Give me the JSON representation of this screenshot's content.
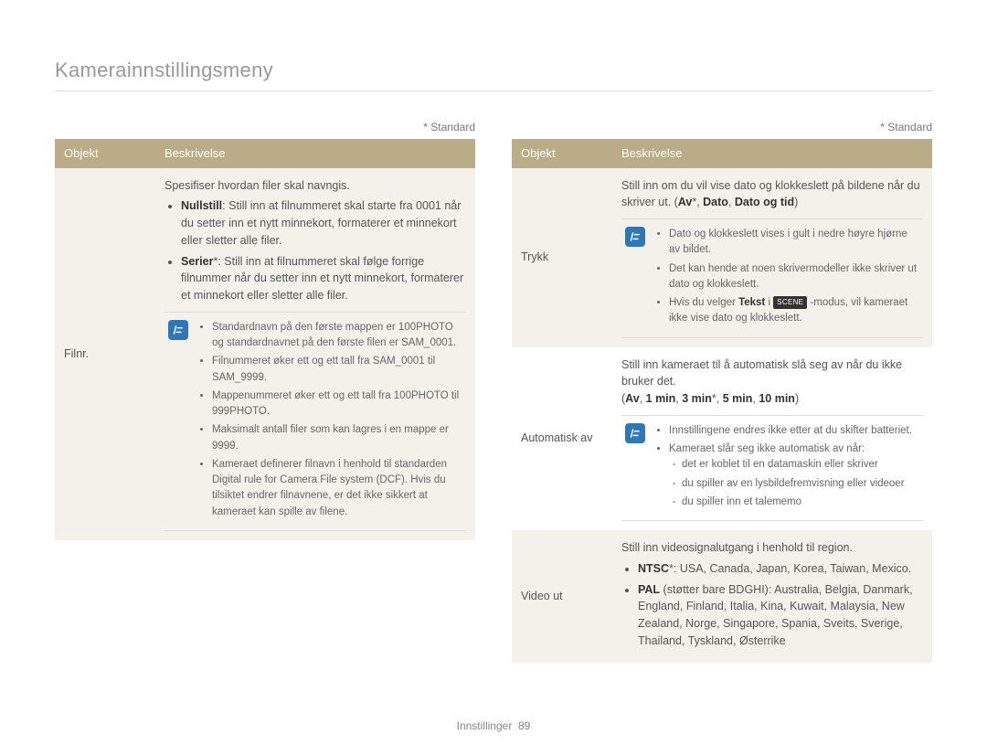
{
  "page_title": "Kamerainnstillingsmeny",
  "standard_label": "* Standard",
  "header": {
    "objekt": "Objekt",
    "beskrivelse": "Beskrivelse"
  },
  "footer": {
    "section": "Innstillinger",
    "page": "89"
  },
  "left": {
    "filnr": {
      "label": "Filnr.",
      "intro": "Spesifiser hvordan filer skal navngis.",
      "opt1_bold": "Nullstill",
      "opt1_rest": ": Still inn at filnummeret skal starte fra 0001 når du setter inn et nytt minnekort, formaterer et minnekort eller sletter alle filer.",
      "opt2_bold": "Serier",
      "opt2_rest": "*: Still inn at filnummeret skal følge forrige filnummer når du setter inn et nytt minnekort, formaterer et minnekort eller sletter alle filer.",
      "notes": [
        "Standardnavn på den første mappen er 100PHOTO og standardnavnet på den første filen er SAM_0001.",
        "Filnummeret øker ett og ett tall fra SAM_0001 til SAM_9999.",
        "Mappenummeret øker ett og ett tall fra 100PHOTO til 999PHOTO.",
        "Maksimalt antall filer som kan lagres i en mappe er 9999.",
        "Kameraet definerer filnavn i henhold til standarden Digital rule for Camera File system (DCF). Hvis du tilsiktet endrer filnavnene, er det ikke sikkert at kameraet kan spille av filene."
      ]
    }
  },
  "right": {
    "trykk": {
      "label": "Trykk",
      "intro_pre": "Still inn om du vil vise dato og klokkeslett på bildene når du skriver ut. (",
      "opt_bold1": "Av",
      "opt_bold2": "Dato",
      "opt_bold3": "Dato og tid",
      "sep": ", ",
      "star": "*",
      "close": ")",
      "notes_a": "Dato og klokkeslett vises i gult i nedre høyre hjørne av bildet.",
      "notes_b": "Det kan hende at noen skrivermodeller ikke skriver ut dato og klokkeslett.",
      "notes_c_pre": "Hvis du velger ",
      "notes_c_bold": "Tekst",
      "notes_c_mid": " i ",
      "notes_c_post": " -modus, vil kameraet ikke vise dato og klokkeslett.",
      "scene_label": "SCENE"
    },
    "auto": {
      "label": "Automatisk av",
      "intro": "Still inn kameraet til å automatisk slå seg av når du ikke bruker det.",
      "options_pre": "(",
      "o1": "Av",
      "o2": "1 min",
      "o3": "3 min",
      "o4": "5 min",
      "o5": "10 min",
      "options_post": ")",
      "notes": {
        "a": "Innstillingene endres ikke etter at du skifter batteriet.",
        "b": "Kameraet slår seg ikke automatisk av når:",
        "sub": [
          "det er koblet til en datamaskin eller skriver",
          "du spiller av en lysbildefremvisning eller videoer",
          "du spiller inn et talememo"
        ]
      }
    },
    "video": {
      "label": "Video ut",
      "intro": "Still inn videosignalutgang i henhold til region.",
      "ntsc_bold": "NTSC",
      "ntsc_rest": "*: USA, Canada, Japan, Korea, Taiwan, Mexico.",
      "pal_bold": "PAL",
      "pal_rest": " (støtter bare BDGHI): Australia, Belgia, Danmark, England, Finland, Italia, Kina, Kuwait, Malaysia, New Zealand, Norge, Singapore, Spania, Sveits, Sverige, Thailand, Tyskland, Østerrike"
    }
  }
}
